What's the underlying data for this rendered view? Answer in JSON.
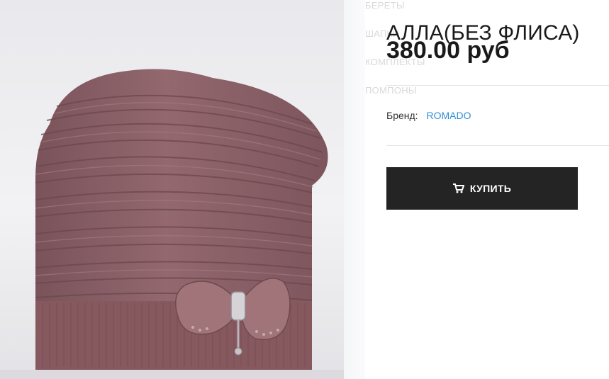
{
  "categories": [
    {
      "label": "БЕРЕТЫ"
    },
    {
      "label": "ШАПКИ"
    },
    {
      "label": "КОМПЛЕКТЫ"
    },
    {
      "label": "ПОМПОНЫ"
    }
  ],
  "product": {
    "title": "АЛЛА(БЕЗ ФЛИСА)",
    "price": "380.00 руб",
    "brand_label": "Бренд:",
    "brand_value": "ROMADO",
    "buy_label": "КУПИТЬ",
    "image_subject": "pink knitted ribbed hat with bow"
  },
  "icons": {
    "buy": "cart-icon"
  },
  "colors": {
    "hat": "#8c6268",
    "button_bg": "#242424",
    "link": "#2f8fd8"
  }
}
